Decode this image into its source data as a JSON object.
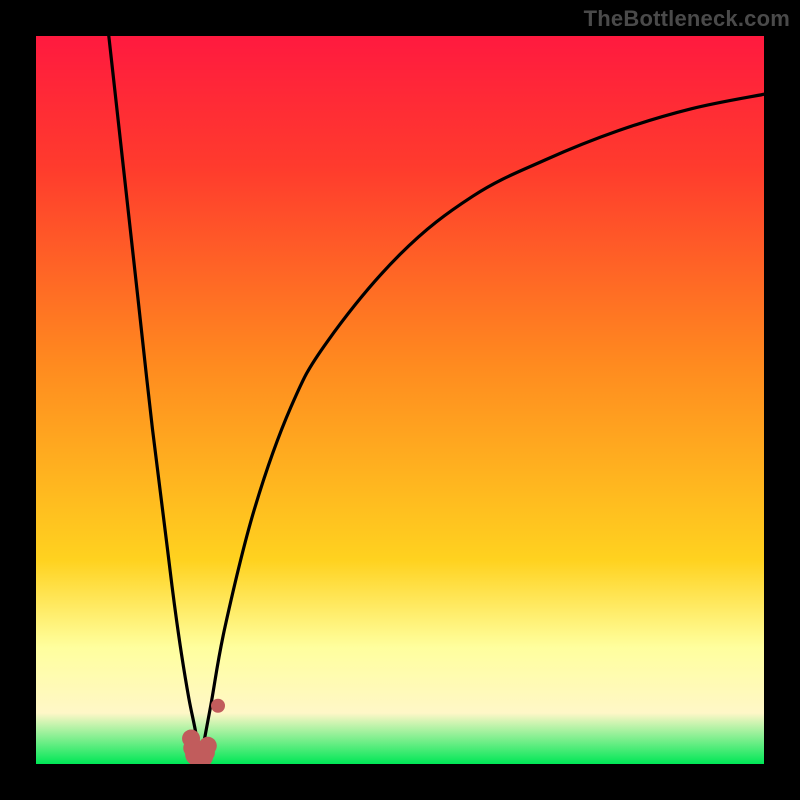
{
  "watermark": "TheBottleneck.com",
  "colors": {
    "frame": "#000000",
    "gradient_top": "#ff1a3f",
    "gradient_upper": "#ff3b2d",
    "gradient_mid": "#ff8a1f",
    "gradient_low": "#ffd21f",
    "gradient_paleband": "#ffff9e",
    "gradient_cream": "#fff7c7",
    "gradient_bottom": "#00e756",
    "curve": "#000000",
    "dots": "#c15c5c"
  },
  "chart_data": {
    "type": "line",
    "title": "",
    "xlabel": "",
    "ylabel": "",
    "xlim": [
      0,
      100
    ],
    "ylim": [
      0,
      100
    ],
    "note": "Axes are unlabeled; y read as bottleneck % (0 bottom, 100 top). Minimum near x≈22.5 where y≈0.",
    "series": [
      {
        "name": "left-branch",
        "x": [
          10,
          12,
          14,
          16,
          18,
          19,
          20,
          21,
          22,
          22.5
        ],
        "values": [
          100,
          82,
          64,
          46,
          30,
          22,
          15,
          9,
          4,
          0
        ]
      },
      {
        "name": "right-branch",
        "x": [
          22.5,
          24,
          26,
          30,
          35,
          40,
          50,
          60,
          70,
          80,
          90,
          100
        ],
        "values": [
          0,
          8,
          19,
          35,
          49,
          58,
          70,
          78,
          83,
          87,
          90,
          92
        ]
      }
    ],
    "markers": {
      "name": "highlight-dots",
      "x": [
        21.3,
        21.6,
        22.0,
        22.4,
        22.8,
        23.2,
        23.6,
        25.0
      ],
      "values": [
        3.5,
        2.2,
        1.3,
        0.9,
        1.0,
        1.6,
        2.5,
        8.0
      ],
      "sizes": [
        9,
        10,
        11,
        11,
        11,
        10,
        9,
        7
      ]
    }
  }
}
